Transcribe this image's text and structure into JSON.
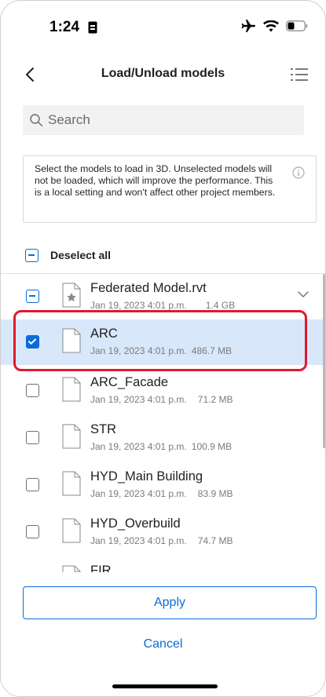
{
  "status_bar": {
    "time": "1:24",
    "icons": [
      "sim-card-icon",
      "airplane-icon",
      "wifi-icon",
      "battery-icon"
    ]
  },
  "nav": {
    "title": "Load/Unload models",
    "back_icon": "chevron-left-icon",
    "menu_icon": "list-icon"
  },
  "search": {
    "placeholder": "Search",
    "value": ""
  },
  "info": {
    "text": "Select the models to load in 3D. Unselected models will not be loaded, which will improve the performance. This is a local setting and won't affect other project members.",
    "icon": "info-icon"
  },
  "deselect_all": {
    "label": "Deselect all",
    "state": "partial"
  },
  "models": [
    {
      "name": "Federated Model.rvt",
      "date": "Jan 19, 2023 4:01 p.m.",
      "size": "1.4 GB",
      "state": "partial",
      "icon": "star-file-icon",
      "expandable": true
    },
    {
      "name": "ARC",
      "date": "Jan 19, 2023 4:01 p.m.",
      "size": "486.7 MB",
      "state": "checked",
      "icon": "file-icon",
      "highlighted": true
    },
    {
      "name": "ARC_Facade",
      "date": "Jan 19, 2023 4:01 p.m.",
      "size": "71.2 MB",
      "state": "empty",
      "icon": "file-icon"
    },
    {
      "name": "STR",
      "date": "Jan 19, 2023 4:01 p.m.",
      "size": "100.9 MB",
      "state": "empty",
      "icon": "file-icon"
    },
    {
      "name": "HYD_Main Building",
      "date": "Jan 19, 2023 4:01 p.m.",
      "size": "83.9 MB",
      "state": "empty",
      "icon": "file-icon"
    },
    {
      "name": "HYD_Overbuild",
      "date": "Jan 19, 2023 4:01 p.m.",
      "size": "74.7 MB",
      "state": "empty",
      "icon": "file-icon"
    },
    {
      "name": "FIR",
      "date": "",
      "size": "",
      "state": "empty",
      "icon": "file-icon"
    }
  ],
  "buttons": {
    "apply": "Apply",
    "cancel": "Cancel"
  },
  "colors": {
    "accent": "#0a6cd8",
    "highlight_row": "#d9e7fb",
    "annotation_outline": "#e0192b"
  }
}
